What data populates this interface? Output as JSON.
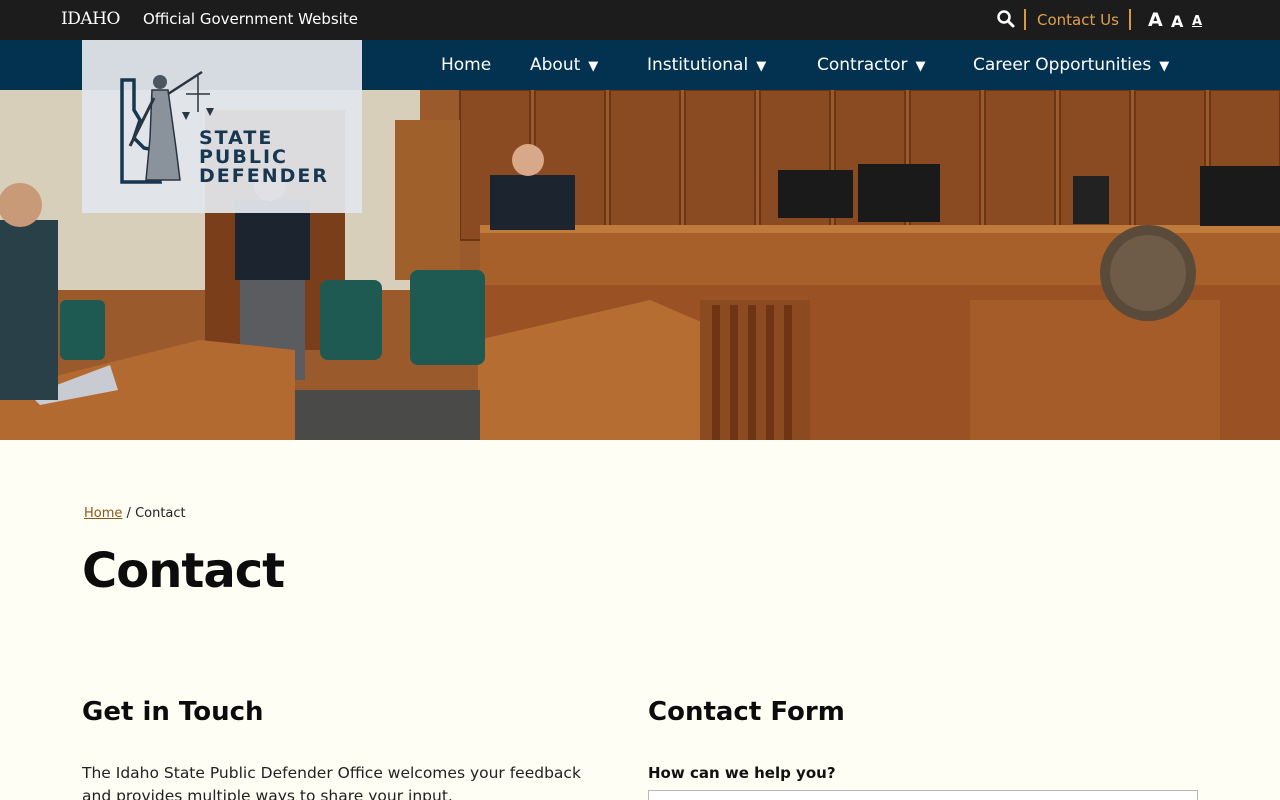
{
  "utility": {
    "idaho_logo": "IDAHO",
    "official_text": "Official Government Website",
    "contact_link": "Contact Us",
    "font_sizes": [
      "A",
      "A",
      "A"
    ]
  },
  "nav": {
    "items": [
      {
        "label": "Home",
        "has_dropdown": false
      },
      {
        "label": "About",
        "has_dropdown": true
      },
      {
        "label": "Institutional",
        "has_dropdown": true
      },
      {
        "label": "Contractor",
        "has_dropdown": true
      },
      {
        "label": "Career Opportunities",
        "has_dropdown": true
      }
    ]
  },
  "logo": {
    "line1": "STATE",
    "line2": "PUBLIC",
    "line3": "DEFENDER"
  },
  "breadcrumb": {
    "home": "Home",
    "separator": "/",
    "current": "Contact"
  },
  "page_title": "Contact",
  "get_in_touch": {
    "heading": "Get in Touch",
    "text": "The Idaho State Public Defender Office welcomes your feedback and provides multiple ways to share your input."
  },
  "contact_form": {
    "heading": "Contact Form",
    "question_label": "How can we help you?"
  },
  "colors": {
    "utility_bg": "#1c1c1c",
    "nav_bg": "#033250",
    "accent": "#d99a3a",
    "page_bg": "#fefef4"
  }
}
